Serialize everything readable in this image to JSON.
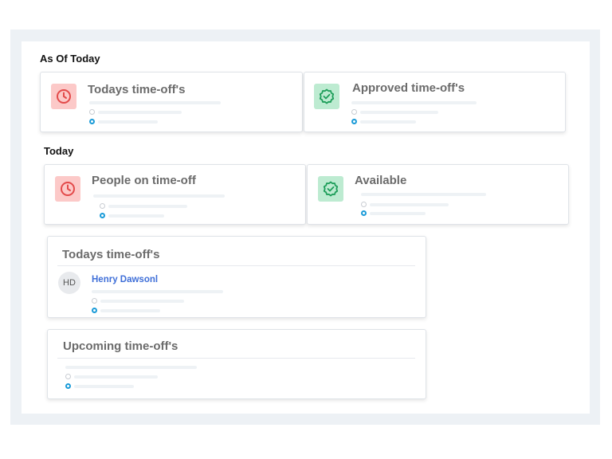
{
  "sections": {
    "as_of_today": "As Of Today",
    "today": "Today"
  },
  "as_of_today_cards": {
    "todays_time_offs": "Todays time-off's",
    "approved_time_offs": "Approved time-off's"
  },
  "today_cards": {
    "people_on_time_off": "People on time-off",
    "available": "Available"
  },
  "todays_list": {
    "title": "Todays time-off's",
    "people": [
      {
        "initials": "HD",
        "name": "Henry Dawsonl"
      }
    ]
  },
  "upcoming_list": {
    "title": "Upcoming time-off's"
  },
  "icons": {
    "clock": "clock-icon",
    "verified": "verified-badge-icon"
  },
  "colors": {
    "red_icon_bg": "#fcc9c8",
    "red_icon_fg": "#e34a4a",
    "green_icon_bg": "#bdebd1",
    "green_icon_fg": "#1e9e5a",
    "name_link": "#3f6fd8",
    "active_dot": "#1a9bd8"
  }
}
